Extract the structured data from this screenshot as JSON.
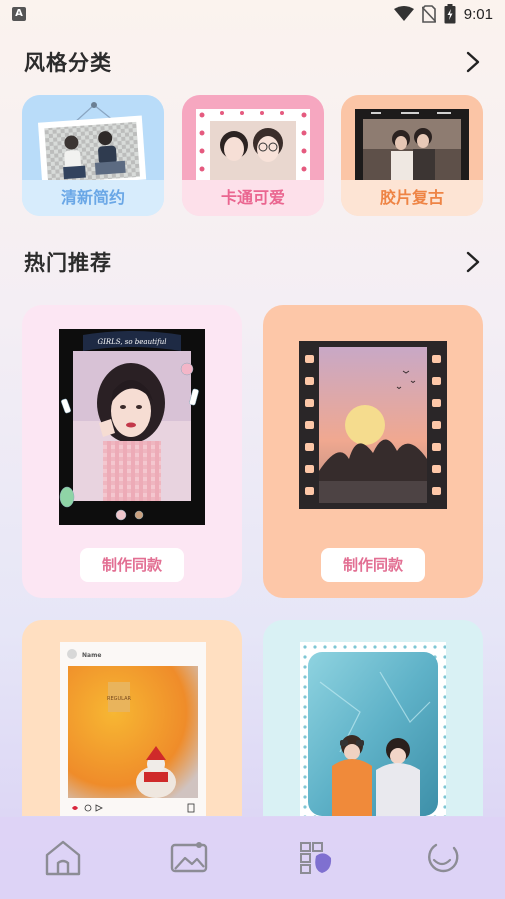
{
  "status_bar": {
    "app_badge": "A",
    "time": "9:01"
  },
  "categories_section": {
    "title": "风格分类",
    "items": [
      {
        "label": "清新简约",
        "color": "#7eb6ec"
      },
      {
        "label": "卡通可爱",
        "color": "#ec6f96"
      },
      {
        "label": "胶片复古",
        "color": "#ee8a50"
      }
    ]
  },
  "recommend_section": {
    "title": "热门推荐",
    "cards": [
      {
        "button_label": "制作同款",
        "banner_text": "GIRLS, so beautiful"
      },
      {
        "button_label": "制作同款"
      },
      {
        "post_name": "Name",
        "sign_text": "REGULAR"
      },
      {}
    ]
  },
  "bottom_nav": {
    "items": [
      "home-icon",
      "gallery-icon",
      "templates-icon",
      "profile-icon"
    ]
  }
}
